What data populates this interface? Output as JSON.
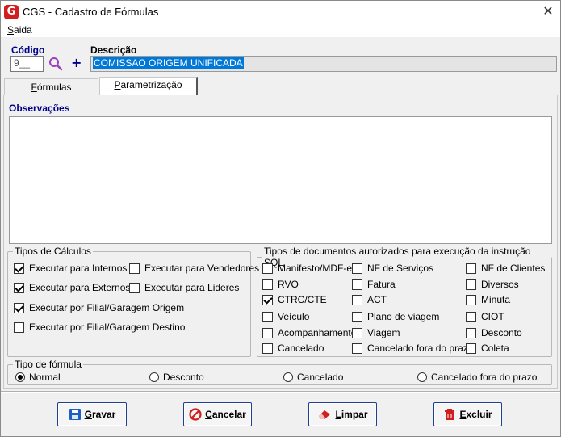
{
  "window": {
    "title": "CGS - Cadastro de Fórmulas",
    "app_icon": "G",
    "close_glyph": "✕"
  },
  "menu": {
    "items": [
      {
        "label": "Saida",
        "accel": "S",
        "rest": "aida"
      }
    ]
  },
  "form": {
    "codigo_label": "Código",
    "codigo_value": "9__",
    "descricao_label": "Descrição",
    "descricao_value": "COMISSAO ORIGEM UNIFICADA",
    "search_icon": "magnifier-icon",
    "add_icon": "plus-icon",
    "plus_glyph": "+"
  },
  "tabs": [
    {
      "label": "Fórmulas",
      "accel": "F",
      "rest": "órmulas",
      "active": false
    },
    {
      "label": "Parametrização",
      "accel": "P",
      "rest": "arametrização",
      "active": true
    }
  ],
  "observacoes": {
    "label": "Observações",
    "value": ""
  },
  "tipos_calculos": {
    "legend": "Tipos de Cálculos",
    "items": [
      {
        "label": "Executar para Internos",
        "checked": true
      },
      {
        "label": "Executar para Vendedores",
        "checked": false
      },
      {
        "label": "Executar para Externos",
        "checked": true
      },
      {
        "label": "Executar para Lideres",
        "checked": false
      },
      {
        "label": "Executar por Filial/Garagem Origem",
        "checked": true
      },
      {
        "label": "Executar por Filial/Garagem Destino",
        "checked": false
      }
    ]
  },
  "tipos_documentos": {
    "legend": "Tipos de documentos autorizados para execução da instrução SQL",
    "items": [
      {
        "label": "Manifesto/MDF-e",
        "checked": false
      },
      {
        "label": "NF de Serviços",
        "checked": false
      },
      {
        "label": "NF de Clientes",
        "checked": false
      },
      {
        "label": "RVO",
        "checked": false
      },
      {
        "label": "Fatura",
        "checked": false
      },
      {
        "label": "Diversos",
        "checked": false
      },
      {
        "label": "CTRC/CTE",
        "checked": true
      },
      {
        "label": "ACT",
        "checked": false
      },
      {
        "label": "Minuta",
        "checked": false
      },
      {
        "label": "Veículo",
        "checked": false
      },
      {
        "label": "Plano de viagem",
        "checked": false
      },
      {
        "label": "CIOT",
        "checked": false
      },
      {
        "label": "Acompanhamento",
        "checked": false
      },
      {
        "label": "Viagem",
        "checked": false
      },
      {
        "label": "Desconto",
        "checked": false
      },
      {
        "label": "Cancelado",
        "checked": false
      },
      {
        "label": "Cancelado fora do prazo",
        "checked": false
      },
      {
        "label": "Coleta",
        "checked": false
      }
    ]
  },
  "tipo_formula": {
    "legend": "Tipo de fórmula",
    "options": [
      {
        "label": "Normal",
        "selected": true
      },
      {
        "label": "Desconto",
        "selected": false
      },
      {
        "label": "Cancelado",
        "selected": false
      },
      {
        "label": "Cancelado fora do prazo",
        "selected": false
      }
    ]
  },
  "buttons": [
    {
      "label": "Gravar",
      "accel": "G",
      "rest": "ravar",
      "icon": "floppy-disk-icon",
      "color": "#1f5fbf"
    },
    {
      "label": "Cancelar",
      "accel": "C",
      "rest": "ancelar",
      "icon": "cancel-circle-icon",
      "color": "#d11e1e"
    },
    {
      "label": "Limpar",
      "accel": "L",
      "rest": "impar",
      "icon": "eraser-icon",
      "color": "#d11e1e"
    },
    {
      "label": "Excluir",
      "accel": "E",
      "rest": "xcluir",
      "icon": "trash-icon",
      "color": "#d11e1e"
    }
  ]
}
